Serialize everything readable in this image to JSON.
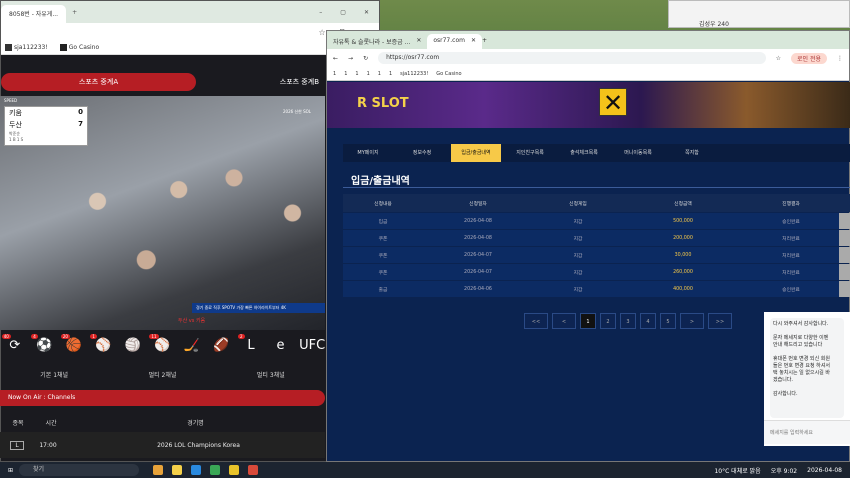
{
  "note": {
    "text": "김성우 240"
  },
  "left_window": {
    "tab_title": "8058번 - 자유게...",
    "bookmarks": [
      "sja112233!",
      "Go Casino"
    ],
    "stream_tabs": [
      "스포츠 중계A",
      "스포츠 중계B"
    ],
    "speed": "SPEED",
    "score": {
      "team1": "키움",
      "score1": "0",
      "team2": "두산",
      "score2": "7",
      "inning": "2",
      "pitcher": "박준순",
      "count": "1 B 1 S",
      "stat": "7 B 18 S 1안타"
    },
    "broadcaster": "2026 신한 SOL",
    "ticker": "경기 중료 직후  SPOTV  가장 빠른 하이라이트부터 4K",
    "vs": "두산 vs 키움",
    "sport_icons": [
      {
        "g": "⟳",
        "b": "40"
      },
      {
        "g": "⚽",
        "b": "4"
      },
      {
        "g": "🏀",
        "b": "20"
      },
      {
        "g": "⚾",
        "b": "1"
      },
      {
        "g": "🏐",
        "b": ""
      },
      {
        "g": "⚾",
        "b": "11"
      },
      {
        "g": "🏒",
        "b": ""
      },
      {
        "g": "🏈",
        "b": ""
      },
      {
        "g": "L",
        "b": "2"
      },
      {
        "g": "e",
        "b": ""
      },
      {
        "g": "UFC",
        "b": ""
      }
    ],
    "channels": [
      "기본 1채널",
      "멀티 2채널",
      "멀티 3채널"
    ],
    "onair": "Now On Air : Channels",
    "table_headers": [
      "종목",
      "시간",
      "경기명"
    ],
    "row": {
      "sport": "L",
      "time": "17:00",
      "name": "2026 LOL Champions Korea"
    }
  },
  "right_window": {
    "tabs": [
      "자유톡 & 슬롯나라 - 보증금 ...",
      "osr77.com"
    ],
    "url": "https://osr77.com",
    "profile": "로인 전용",
    "bookmarks": [
      "1",
      "1",
      "1",
      "1",
      "1",
      "1",
      "sja112233!",
      "Go Casino"
    ],
    "banner_text": "R SLOT",
    "menu": [
      "MY페이지",
      "정보수정",
      "입금/출금내역",
      "지인친구목록",
      "출석체크목록",
      "머니이동목록",
      "쪽지함"
    ],
    "page_title": "입금/출금내역",
    "columns": [
      "신청내용",
      "신청일자",
      "신청게임",
      "신청금액",
      "진행결과"
    ],
    "rows": [
      [
        "입금",
        "2026-04-08",
        "지갑",
        "500,000",
        "승인완료"
      ],
      [
        "쿠폰",
        "2026-04-08",
        "지갑",
        "200,000",
        "처리완료"
      ],
      [
        "쿠폰",
        "2026-04-07",
        "지갑",
        "30,000",
        "처리완료"
      ],
      [
        "쿠폰",
        "2026-04-07",
        "지갑",
        "260,000",
        "처리완료"
      ],
      [
        "출금",
        "2026-04-06",
        "지갑",
        "400,000",
        "승인완료"
      ]
    ],
    "pager": [
      "<<",
      "<",
      "1",
      "2",
      "3",
      "4",
      "5",
      ">",
      ">>"
    ],
    "chat_lines": [
      "다시 와주셔서 감사합니다.",
      "",
      "문자 메세지로 다양한 이벤",
      "안내 해드리고 있습니다",
      "",
      "휴대폰 번호 변경 되신 회원",
      "들은 번호 변경 요청 하셔서",
      "택 놓치시는 일 없으시길 바",
      "겠습니다.",
      "",
      "감사합니다."
    ],
    "chat_placeholder": "메세지를 입력하세요"
  },
  "taskbar": {
    "search": "찾기",
    "weather": "10°C 대체로 맑음",
    "time": "오후 9:02",
    "date": "2026-04-08"
  }
}
